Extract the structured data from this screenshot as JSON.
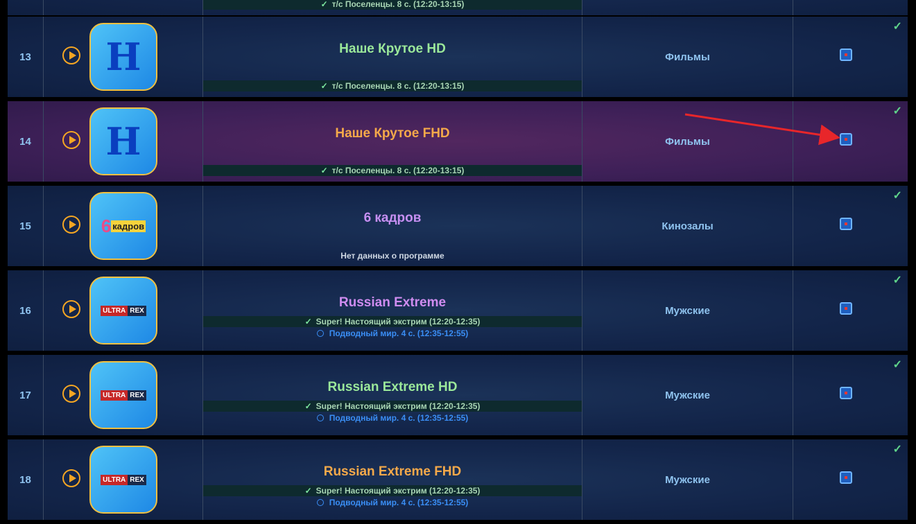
{
  "rows": [
    {
      "num": "",
      "category": "",
      "title": "",
      "title_color": "#b8f0a0",
      "logo": "none",
      "now": "т/с Поселенцы. 8 с. (12:20-13:15)",
      "next": "",
      "nodata": ""
    },
    {
      "num": "13",
      "category": "Фильмы",
      "title": "Наше Крутое HD",
      "title_color": "#9be89a",
      "logo": "nk",
      "now": "т/с Поселенцы. 8 с. (12:20-13:15)",
      "next": "",
      "nodata": ""
    },
    {
      "num": "14",
      "category": "Фильмы",
      "title": "Наше Крутое FHD",
      "title_color": "#f5a94a",
      "logo": "nk",
      "now": "т/с Поселенцы. 8 с. (12:20-13:15)",
      "next": "",
      "nodata": "",
      "highlight": true
    },
    {
      "num": "15",
      "category": "Кинозалы",
      "title": "6 кадров",
      "title_color": "#c68ff2",
      "logo": "6k",
      "now": "",
      "next": "",
      "nodata": "Нет данных о программе"
    },
    {
      "num": "16",
      "category": "Мужские",
      "title": "Russian Extreme",
      "title_color": "#cf8cf0",
      "logo": "ur",
      "now": "Super! Настоящий экстрим (12:20-12:35)",
      "next": "Подводный мир. 4 с. (12:35-12:55)",
      "nodata": ""
    },
    {
      "num": "17",
      "category": "Мужские",
      "title": "Russian Extreme HD",
      "title_color": "#9be89a",
      "logo": "ur",
      "now": "Super! Настоящий экстрим (12:20-12:35)",
      "next": "Подводный мир. 4 с. (12:35-12:55)",
      "nodata": ""
    },
    {
      "num": "18",
      "category": "Мужские",
      "title": "Russian Extreme FHD",
      "title_color": "#f5a94a",
      "logo": "ur",
      "now": "Super! Настоящий экстрим (12:20-12:35)",
      "next": "Подводный мир. 4 с. (12:35-12:55)",
      "nodata": ""
    }
  ],
  "logos": {
    "nk": "Н",
    "six": "6",
    "kadrov": "кадров",
    "ultra": "ULTRA",
    "rex": "REX"
  },
  "icons": {
    "play": "play-icon",
    "check": "✓",
    "selected": "checkbox-checked-icon"
  },
  "arrow_color": "#e8262a"
}
